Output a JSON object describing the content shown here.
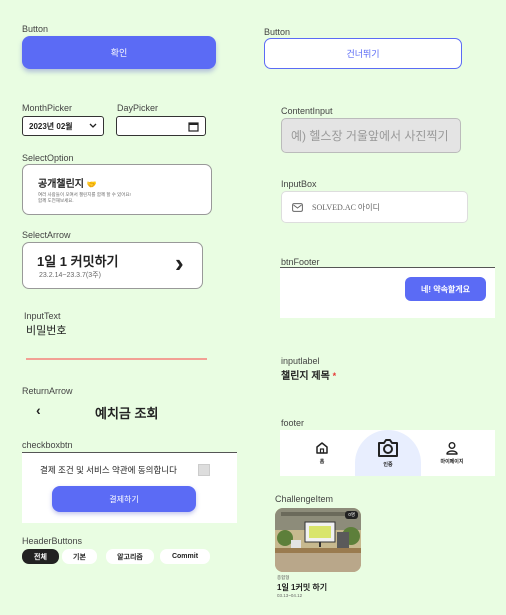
{
  "labels": {
    "button_left": "Button",
    "button_right": "Button",
    "month_picker": "MonthPicker",
    "day_picker": "DayPicker",
    "select_option": "SelectOption",
    "select_arrow": "SelectArrow",
    "input_text": "InputText",
    "return_arrow": "ReturnArrow",
    "checkboxbtn": "checkboxbtn",
    "header_buttons": "HeaderButtons",
    "content_input": "ContentInput",
    "input_box": "InputBox",
    "btn_footer": "btnFooter",
    "inputlabel": "inputlabel",
    "footer": "footer",
    "challenge_item": "ChallengeItem"
  },
  "buttons": {
    "confirm": "확인",
    "skip": "건너뛰기"
  },
  "month_picker": {
    "value": "2023년 02월"
  },
  "select_option": {
    "title": "공개챌린지",
    "emoji": "🤝",
    "desc1": "여러 사람들이 모여서 챌린지를 함께 할 수 있어요!",
    "desc2": "함께 도전해보세요."
  },
  "select_arrow": {
    "title": "1일 1 커밋하기",
    "subtitle": "23.2.14~23.3.7(3주)",
    "arrow": "›"
  },
  "input_text": {
    "value": "비밀번호"
  },
  "return_arrow": {
    "arrow": "‹",
    "title": "예치금 조회"
  },
  "checkbox": {
    "label": "결제 조건 및 서비스 약관에 동의합니다",
    "button": "결제하기"
  },
  "header_buttons": [
    "전체",
    "기본",
    "알고리즘",
    "Commit"
  ],
  "content_input": {
    "placeholder": "예) 헬스장 거울앞에서 사진찍기"
  },
  "input_box": {
    "placeholder": "SOLVED.AC 아이디"
  },
  "btn_footer": {
    "button": "네! 약속할게요"
  },
  "inputlabel": {
    "text": "챌린지 제목",
    "required": "*"
  },
  "footer": {
    "home": "홈",
    "auth": "인증",
    "mypage": "마이페이지"
  },
  "challenge": {
    "badge": "0명",
    "category": "종합형",
    "title": "1일 1커밋 하기",
    "dates": "03.13~04.12"
  },
  "colors": {
    "primary": "#5b6bf5",
    "background": "#e9fde2",
    "required": "#e53935"
  }
}
